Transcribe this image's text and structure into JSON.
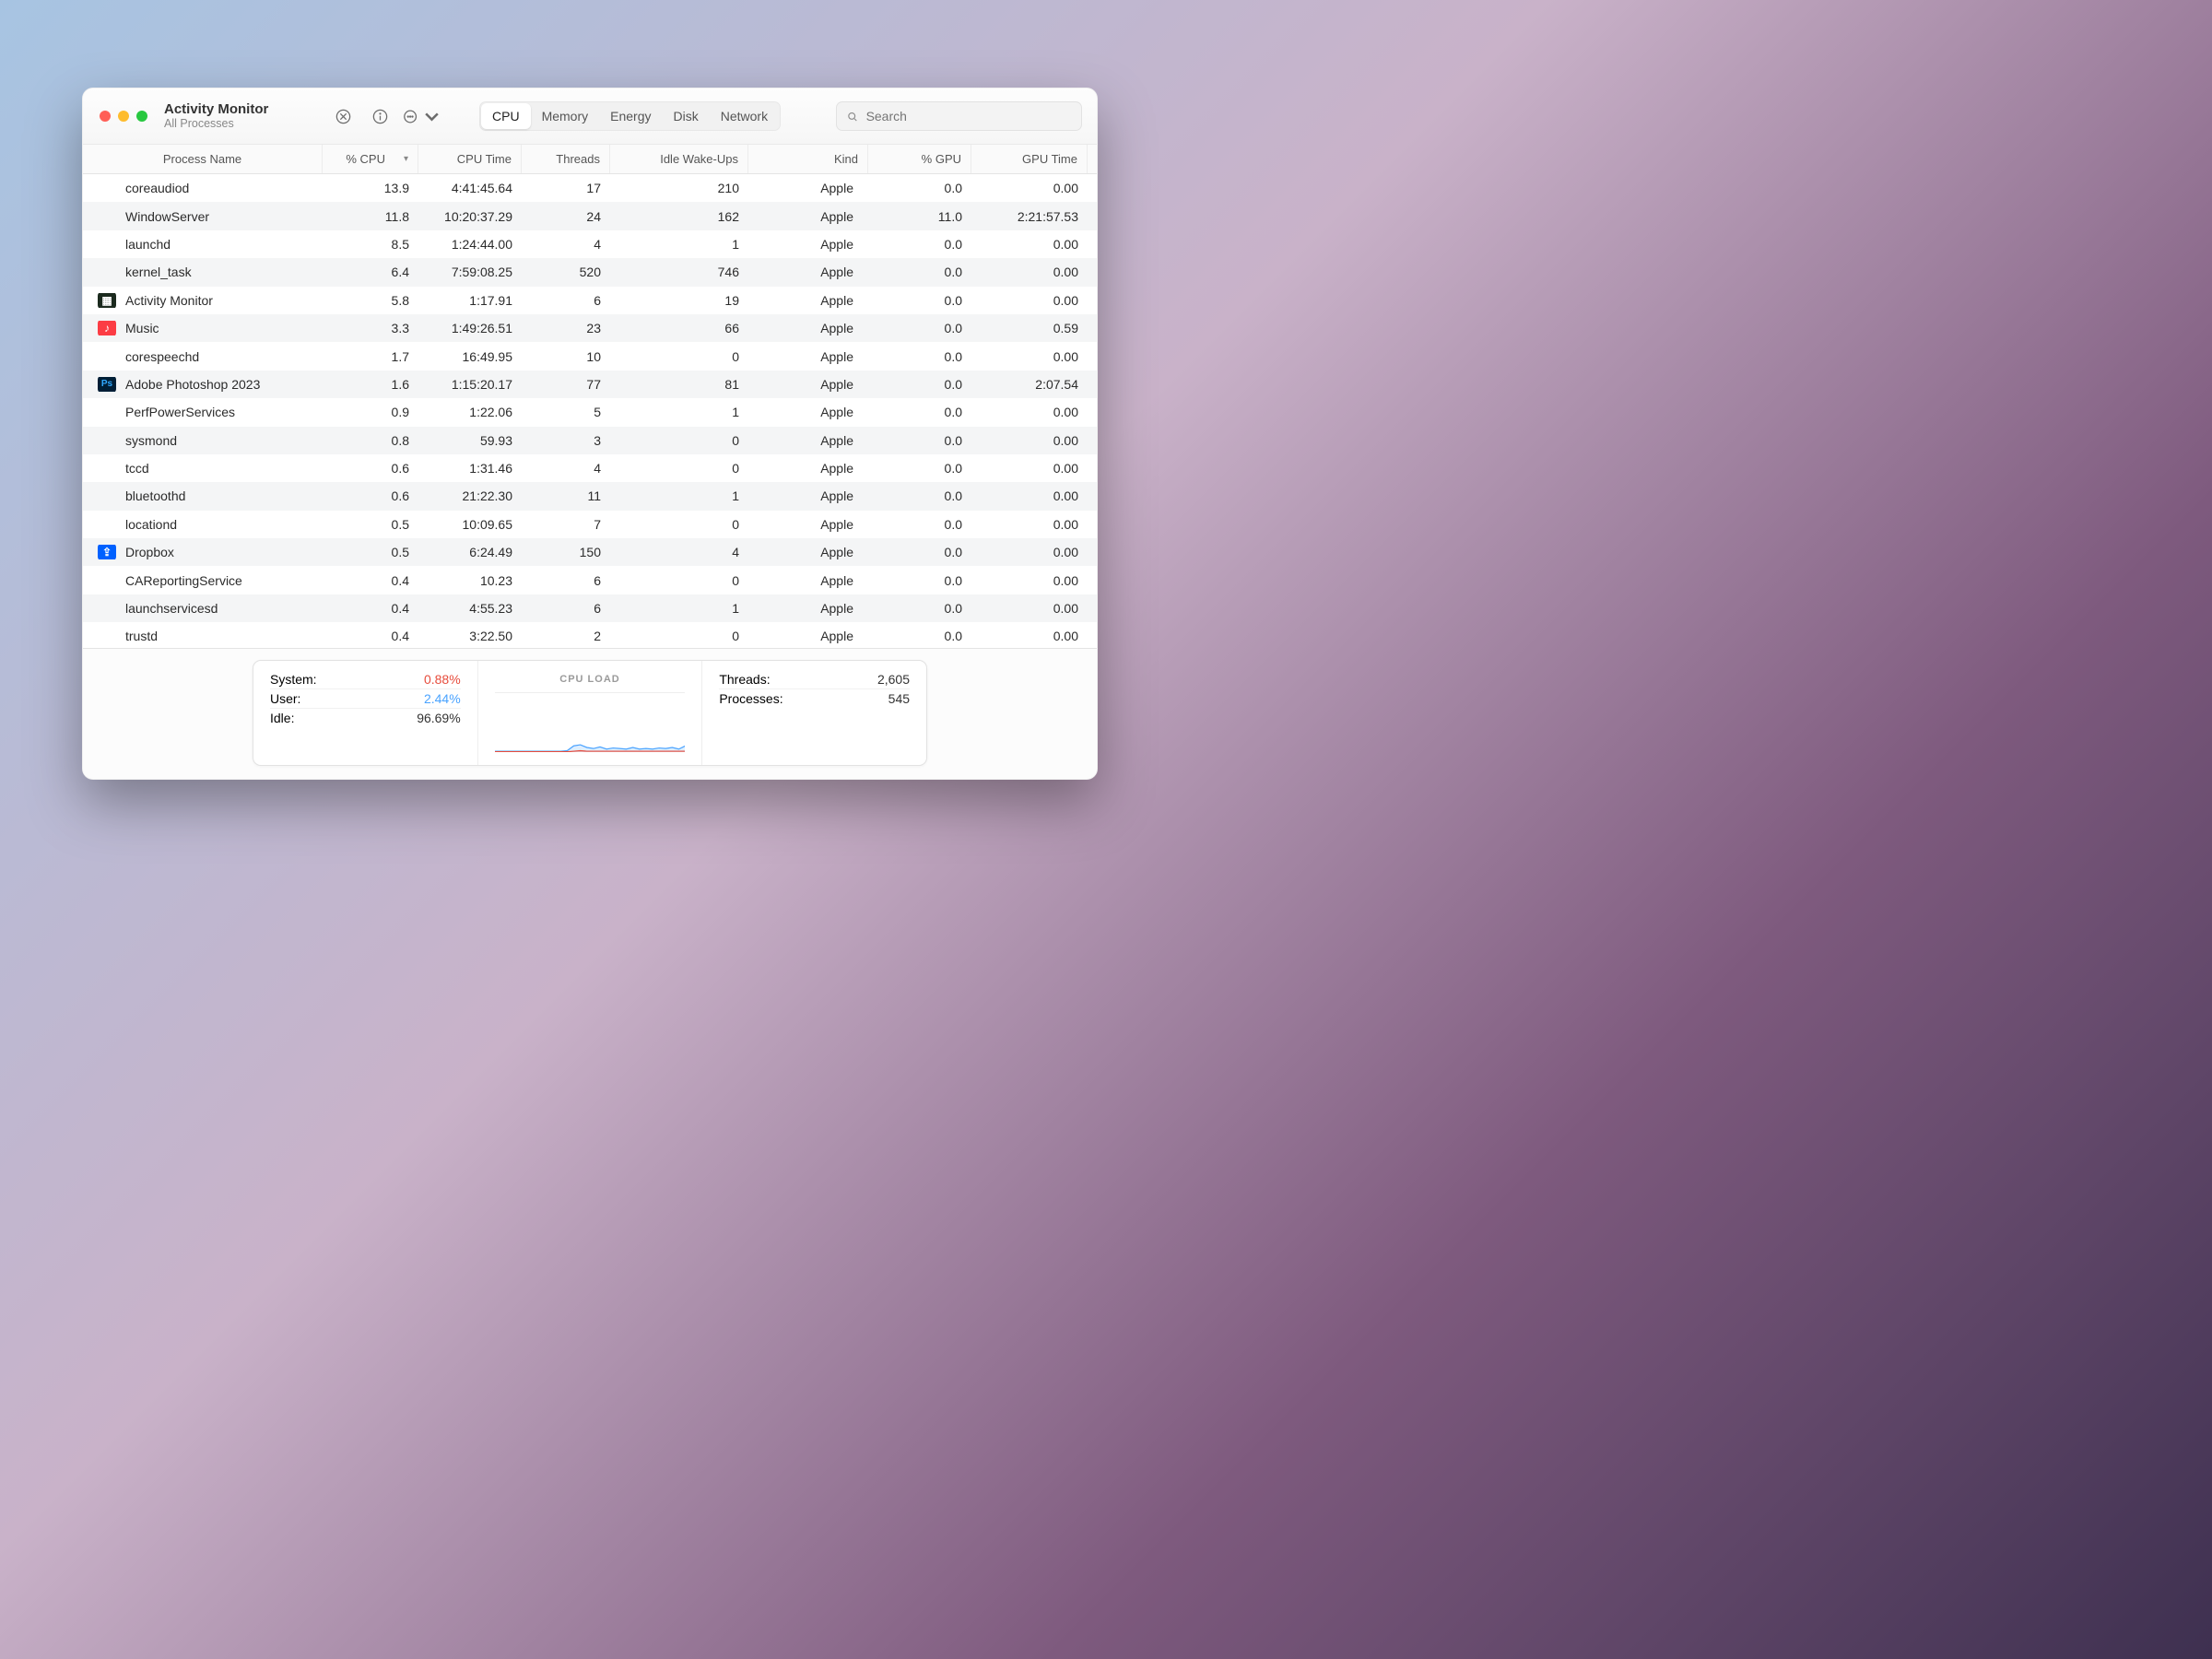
{
  "window": {
    "title": "Activity Monitor",
    "subtitle": "All Processes"
  },
  "tabs": {
    "items": [
      "CPU",
      "Memory",
      "Energy",
      "Disk",
      "Network"
    ],
    "active": 0
  },
  "search": {
    "placeholder": "Search"
  },
  "columns": [
    "Process Name",
    "% CPU",
    "CPU Time",
    "Threads",
    "Idle Wake-Ups",
    "Kind",
    "% GPU",
    "GPU Time"
  ],
  "sort_column_index": 1,
  "rows": [
    {
      "icon": null,
      "name": "coreaudiod",
      "cpu": "13.9",
      "time": "4:41:45.64",
      "threads": "17",
      "wake": "210",
      "kind": "Apple",
      "gpu": "0.0",
      "gtime": "0.00"
    },
    {
      "icon": null,
      "name": "WindowServer",
      "cpu": "11.8",
      "time": "10:20:37.29",
      "threads": "24",
      "wake": "162",
      "kind": "Apple",
      "gpu": "11.0",
      "gtime": "2:21:57.53"
    },
    {
      "icon": null,
      "name": "launchd",
      "cpu": "8.5",
      "time": "1:24:44.00",
      "threads": "4",
      "wake": "1",
      "kind": "Apple",
      "gpu": "0.0",
      "gtime": "0.00"
    },
    {
      "icon": null,
      "name": "kernel_task",
      "cpu": "6.4",
      "time": "7:59:08.25",
      "threads": "520",
      "wake": "746",
      "kind": "Apple",
      "gpu": "0.0",
      "gtime": "0.00"
    },
    {
      "icon": "act",
      "name": "Activity Monitor",
      "cpu": "5.8",
      "time": "1:17.91",
      "threads": "6",
      "wake": "19",
      "kind": "Apple",
      "gpu": "0.0",
      "gtime": "0.00"
    },
    {
      "icon": "music",
      "name": "Music",
      "cpu": "3.3",
      "time": "1:49:26.51",
      "threads": "23",
      "wake": "66",
      "kind": "Apple",
      "gpu": "0.0",
      "gtime": "0.59"
    },
    {
      "icon": null,
      "name": "corespeechd",
      "cpu": "1.7",
      "time": "16:49.95",
      "threads": "10",
      "wake": "0",
      "kind": "Apple",
      "gpu": "0.0",
      "gtime": "0.00"
    },
    {
      "icon": "ps",
      "name": "Adobe Photoshop 2023",
      "cpu": "1.6",
      "time": "1:15:20.17",
      "threads": "77",
      "wake": "81",
      "kind": "Apple",
      "gpu": "0.0",
      "gtime": "2:07.54"
    },
    {
      "icon": null,
      "name": "PerfPowerServices",
      "cpu": "0.9",
      "time": "1:22.06",
      "threads": "5",
      "wake": "1",
      "kind": "Apple",
      "gpu": "0.0",
      "gtime": "0.00"
    },
    {
      "icon": null,
      "name": "sysmond",
      "cpu": "0.8",
      "time": "59.93",
      "threads": "3",
      "wake": "0",
      "kind": "Apple",
      "gpu": "0.0",
      "gtime": "0.00"
    },
    {
      "icon": null,
      "name": "tccd",
      "cpu": "0.6",
      "time": "1:31.46",
      "threads": "4",
      "wake": "0",
      "kind": "Apple",
      "gpu": "0.0",
      "gtime": "0.00"
    },
    {
      "icon": null,
      "name": "bluetoothd",
      "cpu": "0.6",
      "time": "21:22.30",
      "threads": "11",
      "wake": "1",
      "kind": "Apple",
      "gpu": "0.0",
      "gtime": "0.00"
    },
    {
      "icon": null,
      "name": "locationd",
      "cpu": "0.5",
      "time": "10:09.65",
      "threads": "7",
      "wake": "0",
      "kind": "Apple",
      "gpu": "0.0",
      "gtime": "0.00"
    },
    {
      "icon": "db",
      "name": "Dropbox",
      "cpu": "0.5",
      "time": "6:24.49",
      "threads": "150",
      "wake": "4",
      "kind": "Apple",
      "gpu": "0.0",
      "gtime": "0.00"
    },
    {
      "icon": null,
      "name": "CAReportingService",
      "cpu": "0.4",
      "time": "10.23",
      "threads": "6",
      "wake": "0",
      "kind": "Apple",
      "gpu": "0.0",
      "gtime": "0.00"
    },
    {
      "icon": null,
      "name": "launchservicesd",
      "cpu": "0.4",
      "time": "4:55.23",
      "threads": "6",
      "wake": "1",
      "kind": "Apple",
      "gpu": "0.0",
      "gtime": "0.00"
    },
    {
      "icon": null,
      "name": "trustd",
      "cpu": "0.4",
      "time": "3:22.50",
      "threads": "2",
      "wake": "0",
      "kind": "Apple",
      "gpu": "0.0",
      "gtime": "0.00"
    }
  ],
  "summary": {
    "left": [
      {
        "label": "System:",
        "value": "0.88%",
        "cls": "system"
      },
      {
        "label": "User:",
        "value": "2.44%",
        "cls": "user"
      },
      {
        "label": "Idle:",
        "value": "96.69%",
        "cls": ""
      }
    ],
    "center_title": "CPU LOAD",
    "right": [
      {
        "label": "Threads:",
        "value": "2,605"
      },
      {
        "label": "Processes:",
        "value": "545"
      }
    ]
  },
  "chart_data": {
    "type": "area",
    "title": "CPU LOAD",
    "ylim": [
      0,
      100
    ],
    "x": [
      0,
      1,
      2,
      3,
      4,
      5,
      6,
      7,
      8,
      9,
      10,
      11,
      12,
      13,
      14,
      15,
      16,
      17,
      18,
      19,
      20,
      21,
      22,
      23,
      24,
      25,
      26,
      27,
      28,
      29
    ],
    "series": [
      {
        "name": "System",
        "color": "#e74c3c",
        "values": [
          1,
          1,
          1,
          1,
          1,
          1,
          1,
          1,
          1,
          1,
          1,
          1,
          2,
          3,
          2,
          2,
          2,
          2,
          2,
          2,
          2,
          2,
          2,
          2,
          2,
          2,
          2,
          2,
          2,
          2
        ]
      },
      {
        "name": "User",
        "color": "#4aa3ff",
        "values": [
          2,
          2,
          2,
          2,
          2,
          2,
          2,
          2,
          2,
          2,
          2,
          3,
          12,
          14,
          9,
          7,
          10,
          6,
          8,
          7,
          6,
          9,
          6,
          7,
          6,
          8,
          7,
          9,
          6,
          12
        ]
      }
    ]
  }
}
